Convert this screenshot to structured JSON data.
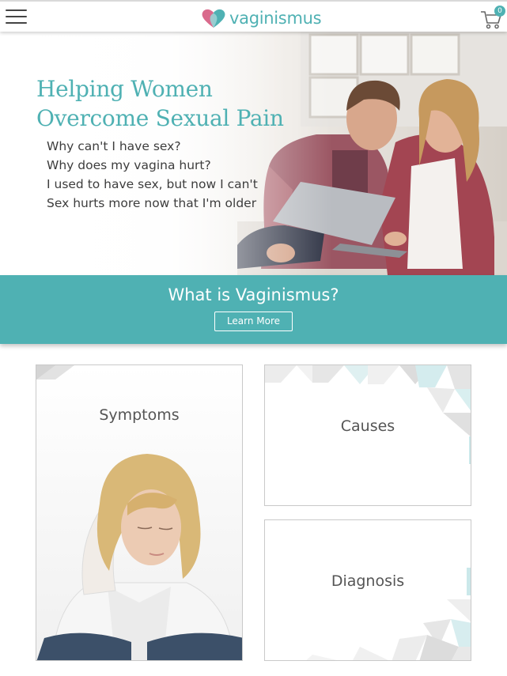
{
  "header": {
    "menu_icon": "hamburger-menu-icon",
    "logo_text": "vaginismus",
    "logo_icon": "heart-logo-icon",
    "cart_icon": "shopping-cart-icon",
    "cart_count": "0"
  },
  "hero": {
    "title": "Helping Women Overcome Sexual Pain",
    "questions": [
      "Why can't I have sex?",
      "Why does my vagina hurt?",
      "I used to have sex, but now I can't",
      "Sex hurts more now that I'm older"
    ],
    "image": "couple-with-laptop-photo"
  },
  "band": {
    "title": "What is Vaginismus?",
    "button_label": "Learn More"
  },
  "cards": {
    "symptoms": {
      "title": "Symptoms",
      "image": "distressed-woman-photo"
    },
    "causes": {
      "title": "Causes"
    },
    "diagnosis": {
      "title": "Diagnosis"
    }
  },
  "colors": {
    "accent": "#4fb1b3",
    "text": "#444444",
    "card_border": "#c9c9c9"
  }
}
